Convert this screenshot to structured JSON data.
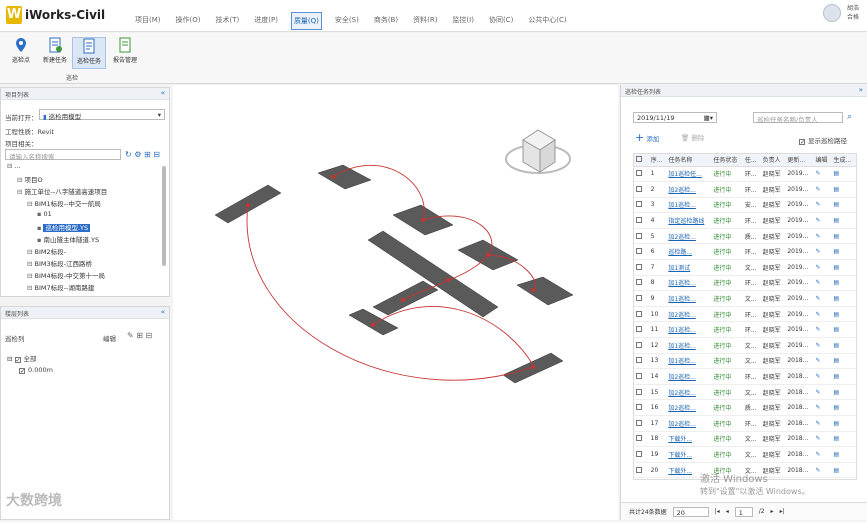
{
  "app": {
    "name": "iWorks-Civil",
    "logo_letter": "W"
  },
  "menu": [
    "项目(M)",
    "操作(O)",
    "技术(T)",
    "进度(P)",
    "质量(Q)",
    "安全(S)",
    "商务(B)",
    "资料(R)",
    "监控(I)",
    "协同(C)",
    "公共中心(C)"
  ],
  "active_menu_index": 4,
  "user": {
    "line1": "胡浩",
    "line2": "合格"
  },
  "ribbon": {
    "buttons": [
      {
        "label": "巡检点",
        "icon": "location-pin-icon"
      },
      {
        "label": "新建任务",
        "icon": "new-task-icon"
      },
      {
        "label": "巡检任务",
        "icon": "inspection-task-icon"
      },
      {
        "label": "报告管理",
        "icon": "report-icon"
      }
    ],
    "selected_index": 2,
    "group_label": "巡检"
  },
  "project_panel": {
    "title": "项目列表",
    "collapse_glyph": "«",
    "open_label": "当前打开：",
    "open_value": "巡检用模型",
    "type_label": "工程性质：",
    "type_value": "Revit",
    "related_label": "项目相关：",
    "search_placeholder": "请输入名称搜索",
    "tree": [
      {
        "text": "...",
        "level": 0
      },
      {
        "text": "项目O",
        "level": 1
      },
      {
        "text": "施工单位--八字隧道高速项目",
        "level": 1
      },
      {
        "text": "BIM1标段--中交一航局",
        "level": 2
      },
      {
        "text": "01",
        "level": 3
      },
      {
        "text": "巡检用模型.YS",
        "level": 3,
        "selected": true
      },
      {
        "text": "南山隧主体隧道.YS",
        "level": 3
      },
      {
        "text": "BIM2标段-",
        "level": 2
      },
      {
        "text": "BIM3标段-江西路桥",
        "level": 2
      },
      {
        "text": "BIM4标段-中交第十一局",
        "level": 2
      },
      {
        "text": "BIM7标段--湖南路建",
        "level": 2
      }
    ]
  },
  "floor_panel": {
    "title": "楼层列表",
    "collapse_glyph": "«",
    "header_label": "巡检列",
    "edit_label": "编辑",
    "items": [
      {
        "text": "全部",
        "checked": true,
        "level": 0
      },
      {
        "text": "0.000m",
        "checked": true,
        "level": 1
      }
    ]
  },
  "task_panel": {
    "title": "巡检任务列表",
    "collapse_glyph": "»",
    "date": "2019/11/19",
    "search_placeholder": "巡检任务名称/负责人",
    "add_label": "添加",
    "delete_label": "删除",
    "show_path_label": "显示巡检路径",
    "columns": [
      "序...",
      "任务名称",
      "任务状态",
      "任...",
      "负责人",
      "更新...",
      "编辑",
      "生成..."
    ],
    "rows": [
      {
        "no": "1",
        "name": "加1巡检任...",
        "status": "进行中",
        "type": "环...",
        "owner": "赵晓军",
        "date": "2019..."
      },
      {
        "no": "2",
        "name": "加2巡检...",
        "status": "进行中",
        "type": "环...",
        "owner": "赵晓军",
        "date": "2019..."
      },
      {
        "no": "3",
        "name": "加1巡检...",
        "status": "进行中",
        "type": "安...",
        "owner": "赵晓军",
        "date": "2019..."
      },
      {
        "no": "4",
        "name": "指定巡检路线",
        "status": "进行中",
        "type": "环...",
        "owner": "赵晓军",
        "date": "2019..."
      },
      {
        "no": "5",
        "name": "加2巡检...",
        "status": "进行中",
        "type": "质...",
        "owner": "赵晓军",
        "date": "2019..."
      },
      {
        "no": "6",
        "name": "巡检路...",
        "status": "进行中",
        "type": "环...",
        "owner": "赵晓军",
        "date": "2019..."
      },
      {
        "no": "7",
        "name": "加1测试",
        "status": "进行中",
        "type": "文...",
        "owner": "赵晓军",
        "date": "2019..."
      },
      {
        "no": "8",
        "name": "加1巡检...",
        "status": "进行中",
        "type": "环...",
        "owner": "赵晓军",
        "date": "2019..."
      },
      {
        "no": "9",
        "name": "加1巡检...",
        "status": "进行中",
        "type": "文...",
        "owner": "赵晓军",
        "date": "2019..."
      },
      {
        "no": "10",
        "name": "加2巡检...",
        "status": "进行中",
        "type": "环...",
        "owner": "赵晓军",
        "date": "2019..."
      },
      {
        "no": "11",
        "name": "加1巡检...",
        "status": "进行中",
        "type": "环...",
        "owner": "赵晓军",
        "date": "2019..."
      },
      {
        "no": "12",
        "name": "加1巡检...",
        "status": "进行中",
        "type": "文...",
        "owner": "赵晓军",
        "date": "2019..."
      },
      {
        "no": "13",
        "name": "加1巡检...",
        "status": "进行中",
        "type": "文...",
        "owner": "赵晓军",
        "date": "2018..."
      },
      {
        "no": "14",
        "name": "加2巡检...",
        "status": "进行中",
        "type": "环...",
        "owner": "赵晓军",
        "date": "2018..."
      },
      {
        "no": "15",
        "name": "加2巡检...",
        "status": "进行中",
        "type": "文...",
        "owner": "赵晓军",
        "date": "2018..."
      },
      {
        "no": "16",
        "name": "加2巡检...",
        "status": "进行中",
        "type": "质...",
        "owner": "赵晓军",
        "date": "2018..."
      },
      {
        "no": "17",
        "name": "加2巡检...",
        "status": "进行中",
        "type": "环...",
        "owner": "赵晓军",
        "date": "2018..."
      },
      {
        "no": "18",
        "name": "下载外...",
        "status": "进行中",
        "type": "文...",
        "owner": "赵晓军",
        "date": "2018..."
      },
      {
        "no": "19",
        "name": "下载外...",
        "status": "进行中",
        "type": "文...",
        "owner": "赵晓军",
        "date": "2018..."
      },
      {
        "no": "20",
        "name": "下载外...",
        "status": "进行中",
        "type": "文...",
        "owner": "赵晓军",
        "date": "2018..."
      }
    ],
    "footer": {
      "total": "共计24条数据",
      "page_size": "20",
      "page": "1",
      "pages": "/2"
    }
  },
  "watermark": {
    "line1": "激活 Windows",
    "line2": "转到\"设置\"以激活 Windows。"
  },
  "brand_watermark": "大数跨境",
  "colors": {
    "accent": "#2c6ec6",
    "status_green": "#2e8b2e",
    "path_red": "#c83232"
  }
}
